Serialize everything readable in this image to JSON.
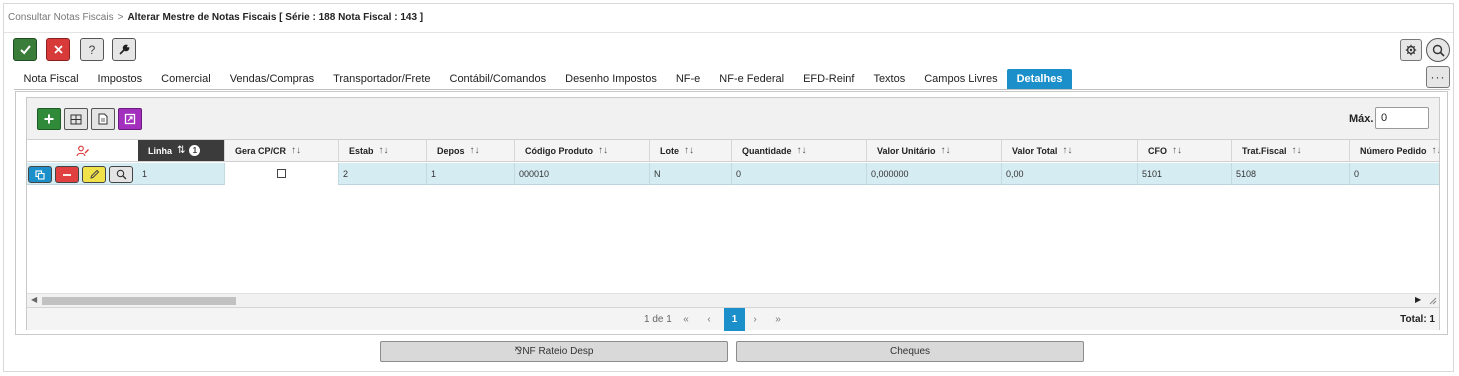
{
  "breadcrumb": {
    "parent": "Consultar Notas Fiscais",
    "separator": ">",
    "current": "Alterar Mestre de Notas Fiscais [ Série : 188 Nota Fiscal : 143 ]"
  },
  "toolbar": {
    "confirm_icon": "check-icon",
    "cancel_icon": "close-icon",
    "help_label": "?",
    "tool_icon": "wrench-icon",
    "settings_icon": "gear-icon",
    "search_icon": "search-icon",
    "more_label": "···"
  },
  "tabs": [
    {
      "label": "Nota Fiscal"
    },
    {
      "label": "Impostos"
    },
    {
      "label": "Comercial"
    },
    {
      "label": "Vendas/Compras"
    },
    {
      "label": "Transportador/Frete"
    },
    {
      "label": "Contábil/Comandos"
    },
    {
      "label": "Desenho Impostos"
    },
    {
      "label": "NF-e"
    },
    {
      "label": "NF-e Federal"
    },
    {
      "label": "EFD-Reinf"
    },
    {
      "label": "Textos"
    },
    {
      "label": "Campos Livres"
    },
    {
      "label": "Detalhes",
      "active": true
    }
  ],
  "grid": {
    "max_label": "Máx.",
    "max_value": "0",
    "actions_header_icon": "user-edit-icon",
    "columns": [
      {
        "label": "Linha",
        "sort": "⇅",
        "badge": "1"
      },
      {
        "label": "Gera CP/CR",
        "sort": "↑↓"
      },
      {
        "label": "Estab",
        "sort": "↑↓"
      },
      {
        "label": "Depos",
        "sort": "↑↓"
      },
      {
        "label": "Código Produto",
        "sort": "↑↓"
      },
      {
        "label": "Lote",
        "sort": "↑↓"
      },
      {
        "label": "Quantidade",
        "sort": "↑↓"
      },
      {
        "label": "Valor Unitário",
        "sort": "↑↓"
      },
      {
        "label": "Valor Total",
        "sort": "↑↓"
      },
      {
        "label": "CFO",
        "sort": "↑↓"
      },
      {
        "label": "Trat.Fiscal",
        "sort": "↑↓"
      },
      {
        "label": "Número Pedido",
        "sort": "↑↓"
      }
    ],
    "rows": [
      {
        "linha": "1",
        "gera": "",
        "estab": "2",
        "depos": "1",
        "codigo": "000010",
        "lote": "N",
        "quantidade": "0",
        "valor_unitario": "0,000000",
        "valor_total": "0,00",
        "cfo": "5101",
        "trat_fiscal": "5108",
        "numero_pedido": "0"
      }
    ]
  },
  "pager": {
    "info": "1 de 1",
    "first": "«",
    "prev": "‹",
    "current": "1",
    "next": "›",
    "last": "»",
    "total": "Total: 1"
  },
  "buttons": {
    "rateio": "⅋NF Rateio Desp",
    "cheques": "Cheques"
  },
  "colors": {
    "accent": "#1a8fc9",
    "confirm": "#3a7d3a",
    "cancel": "#d83a3a",
    "row_highlight": "#d6ecf3",
    "purple": "#a22fbd"
  }
}
